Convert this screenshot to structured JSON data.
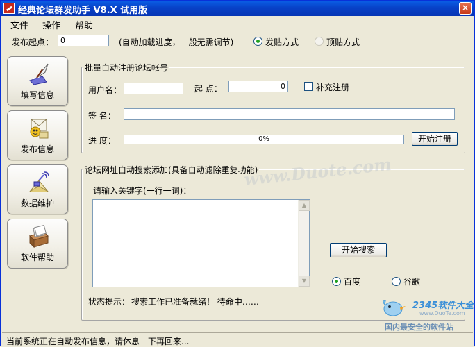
{
  "window": {
    "title": "经典论坛群发助手 V8.X 试用版",
    "close_glyph": "×"
  },
  "menu": {
    "file": "文件",
    "operate": "操作",
    "help": "帮助"
  },
  "toprow": {
    "start_label": "发布起点：",
    "start_value": "0",
    "hint": "(自动加载进度，一般无需调节)",
    "mode_post": "发贴方式",
    "mode_bump": "顶贴方式"
  },
  "sidebar": [
    {
      "label": "填写信息",
      "icon": "quill-pen-icon"
    },
    {
      "label": "发布信息",
      "icon": "mail-envelope-icon"
    },
    {
      "label": "数据维护",
      "icon": "satellite-mail-icon"
    },
    {
      "label": "软件帮助",
      "icon": "card-box-icon"
    }
  ],
  "register": {
    "legend": "批量自动注册论坛帐号",
    "username_label": "用户名：",
    "username_value": "",
    "start_label": "起  点：",
    "start_value": "0",
    "supplement_label": "补充注册",
    "signature_label": "签  名：",
    "signature_value": "",
    "progress_label": "进  度：",
    "progress_text": "0%",
    "progress_value": 0,
    "start_button": "开始注册"
  },
  "search": {
    "legend": "论坛网址自动搜索添加(具备自动滤除重复功能)",
    "keyword_label": "请输入关键字(一行一词)：",
    "keyword_value": "",
    "search_button": "开始搜索",
    "engine_baidu": "百度",
    "engine_google": "谷歌",
    "status_label": "状态提示：",
    "status_text": "搜索工作已准备就绪！ 待命中……"
  },
  "statusbar": {
    "text": "当前系统正在自动发布信息，请休息一下再回来..."
  },
  "watermark": "www.Duote.com",
  "brand": {
    "name": "2345软件大全",
    "url": "www.DuoTe.com",
    "slogan": "国内最安全的软件站"
  },
  "colors": {
    "titlebar": "#0842c8",
    "accent_green": "#21a121",
    "progress_fill": "#3c3cd0"
  }
}
